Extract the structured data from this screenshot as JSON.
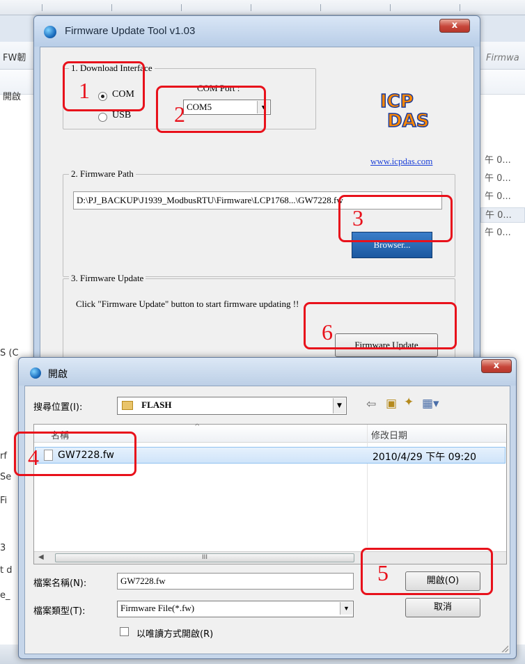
{
  "background": {
    "left_fragments": [
      "FW韌",
      "開啟",
      "S (C",
      "rf",
      "Se",
      "Fi",
      "3",
      "t d",
      "e_"
    ],
    "right_header": "Firmwa",
    "right_rows": [
      "午 0...",
      "午 0...",
      "午 0...",
      "午 0...",
      "午 0..."
    ]
  },
  "fw_tool": {
    "title": "Firmware Update Tool v1.03",
    "close_label": "x",
    "download_interface": {
      "legend": "1. Download Interface",
      "options": [
        "COM",
        "USB"
      ],
      "selected": "COM",
      "com_port_label": "COM Port :",
      "com_port_value": "COM5"
    },
    "logo": {
      "top": "ICP",
      "bottom": "DAS",
      "alt": "ICP DAS logo"
    },
    "website": "www.icpdas.com",
    "firmware_path": {
      "legend": "2. Firmware Path",
      "value": "D:\\PJ_BACKUP\\J1939_ModbusRTU\\Firmware\\LCP1768...\\GW7228.fw",
      "browse_label": "Browser..."
    },
    "firmware_update": {
      "legend": "3. Firmware Update",
      "instruction": "Click  \"Firmware Update\" button to start firmware updating !!",
      "button_label": "Firmware Update"
    }
  },
  "open_dialog": {
    "title": "開啟",
    "close_label": "x",
    "look_in_label": "搜尋位置(I):",
    "look_in_value": "FLASH",
    "columns": [
      "名稱",
      "修改日期"
    ],
    "files": [
      {
        "name": "GW7228.fw",
        "modified": "2010/4/29 下午 09:20"
      }
    ],
    "scroll_grip": "III",
    "filename_label": "檔案名稱(N):",
    "filename_value": "GW7228.fw",
    "filetype_label": "檔案類型(T):",
    "filetype_value": "Firmware File(*.fw)",
    "open_button": "開啟(O)",
    "cancel_button": "取消",
    "readonly_label": "以唯讀方式開啟(R)"
  },
  "annotations": [
    "1",
    "2",
    "3",
    "4",
    "5",
    "6"
  ],
  "colors": {
    "annotation": "#e8111b",
    "browse_button": "#1b58a0",
    "link": "#1a3fd8"
  }
}
